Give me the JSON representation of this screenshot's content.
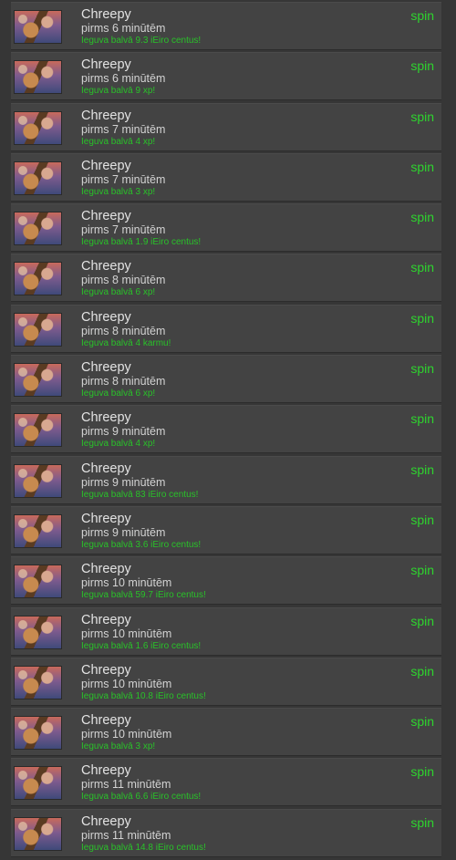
{
  "rows": [
    {
      "user": "Chreepy",
      "time": "pirms 6 minūtēm",
      "reward": "Ieguva balvā 9.3 iEiro centus!",
      "action": "spin"
    },
    {
      "user": "Chreepy",
      "time": "pirms 6 minūtēm",
      "reward": "Ieguva balvā 9 xp!",
      "action": "spin"
    },
    {
      "user": "Chreepy",
      "time": "pirms 7 minūtēm",
      "reward": "Ieguva balvā 4 xp!",
      "action": "spin"
    },
    {
      "user": "Chreepy",
      "time": "pirms 7 minūtēm",
      "reward": "Ieguva balvā 3 xp!",
      "action": "spin"
    },
    {
      "user": "Chreepy",
      "time": "pirms 7 minūtēm",
      "reward": "Ieguva balvā 1.9 iEiro centus!",
      "action": "spin"
    },
    {
      "user": "Chreepy",
      "time": "pirms 8 minūtēm",
      "reward": "Ieguva balvā 6 xp!",
      "action": "spin"
    },
    {
      "user": "Chreepy",
      "time": "pirms 8 minūtēm",
      "reward": "Ieguva balvā 4 karmu!",
      "action": "spin"
    },
    {
      "user": "Chreepy",
      "time": "pirms 8 minūtēm",
      "reward": "Ieguva balvā 6 xp!",
      "action": "spin"
    },
    {
      "user": "Chreepy",
      "time": "pirms 9 minūtēm",
      "reward": "Ieguva balvā 4 xp!",
      "action": "spin"
    },
    {
      "user": "Chreepy",
      "time": "pirms 9 minūtēm",
      "reward": "Ieguva balvā 83 iEiro centus!",
      "action": "spin"
    },
    {
      "user": "Chreepy",
      "time": "pirms 9 minūtēm",
      "reward": "Ieguva balvā 3.6 iEiro centus!",
      "action": "spin"
    },
    {
      "user": "Chreepy",
      "time": "pirms 10 minūtēm",
      "reward": "Ieguva balvā 59.7 iEiro centus!",
      "action": "spin"
    },
    {
      "user": "Chreepy",
      "time": "pirms 10 minūtēm",
      "reward": "Ieguva balvā 1.6 iEiro centus!",
      "action": "spin"
    },
    {
      "user": "Chreepy",
      "time": "pirms 10 minūtēm",
      "reward": "Ieguva balvā 10.8 iEiro centus!",
      "action": "spin"
    },
    {
      "user": "Chreepy",
      "time": "pirms 10 minūtēm",
      "reward": "Ieguva balvā 3 xp!",
      "action": "spin"
    },
    {
      "user": "Chreepy",
      "time": "pirms 11 minūtēm",
      "reward": "Ieguva balvā 6.6 iEiro centus!",
      "action": "spin"
    },
    {
      "user": "Chreepy",
      "time": "pirms 11 minūtēm",
      "reward": "Ieguva balvā 14.8 iEiro centus!",
      "action": "spin"
    }
  ],
  "colors": {
    "background": "#363636",
    "row": "#434343",
    "reward_green": "#29c229",
    "spin_green": "#2ed42e"
  },
  "icons": {
    "avatar": "user-avatar-image"
  }
}
